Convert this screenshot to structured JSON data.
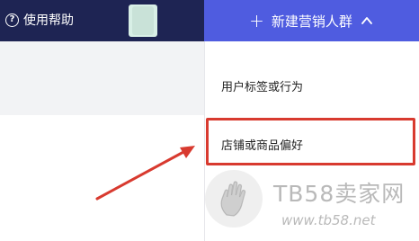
{
  "header": {
    "help_label": "使用帮助",
    "help_icon": "question-circle-icon",
    "create_button_label": "新建营销人群",
    "create_icon": "plus-icon",
    "toggle_icon": "chevron-up-icon",
    "background_color": "#1e2453",
    "accent_color": "#4f5ce0"
  },
  "dropdown": {
    "items": [
      {
        "label": "用户标签或行为"
      },
      {
        "label": "店铺或商品偏好"
      }
    ],
    "highlight_color": "#d83a2f"
  },
  "watermark": {
    "title": "TB58卖家网",
    "url": "www.tb58.net",
    "icon": "hand-icon"
  }
}
